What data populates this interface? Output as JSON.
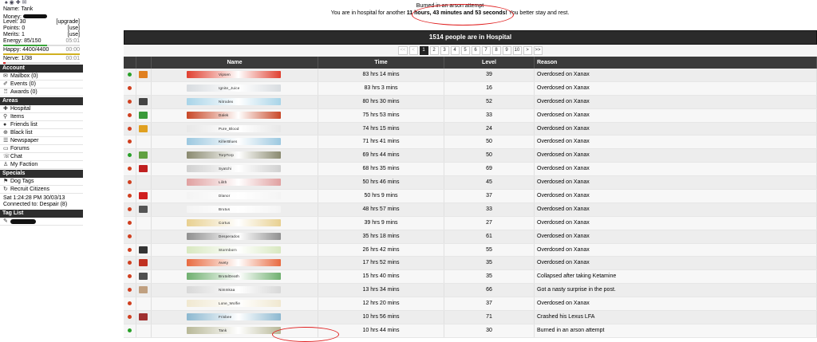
{
  "sidebar": {
    "stats": [
      {
        "label": "Name:",
        "value": "Tank"
      },
      {
        "label": "Money:",
        "value": ""
      },
      {
        "label": "Level:",
        "value": "30",
        "action": "[upgrade]"
      },
      {
        "label": "Points:",
        "value": "0",
        "action": "[use]"
      },
      {
        "label": "Merits:",
        "value": "1",
        "action": "[use]"
      },
      {
        "label": "Energy:",
        "value": "85/150",
        "timer": "05:01"
      },
      {
        "label": "Happy:",
        "value": "4400/4400",
        "timer": "00:00"
      },
      {
        "label": "Nerve:",
        "value": "1/38",
        "timer": "00:01"
      }
    ],
    "bars": {
      "energy": 0.57,
      "happy": 1.0,
      "nerve": 0.03
    },
    "colors": {
      "energy": "#3aa43a",
      "happy": "#d0b020",
      "nerve": "#d02020"
    },
    "account_title": "Account",
    "account": [
      "Mailbox (0)",
      "Events (0)",
      "Awards (0)"
    ],
    "areas_title": "Areas",
    "areas": [
      "Hospital",
      "Items",
      "Friends list",
      "Black list",
      "Newspaper",
      "Forums",
      "Chat",
      "My Faction"
    ],
    "specials_title": "Specials",
    "specials": [
      "Dog Tags",
      "Recruit Citizens"
    ],
    "datetime": "Sat 1:24:28 PM 30/03/13",
    "connected": "Connected to: Despair (8)",
    "taglist_title": "Tag List"
  },
  "banner": {
    "title": "Burned in an arson attempt",
    "prefix": "You are in hospital for another",
    "duration": "11 hours, 43 minutes and 53 seconds!",
    "suffix": "You better stay and rest."
  },
  "hospital": {
    "caption": "1514 people are in Hospital",
    "pages": [
      "<<",
      "<",
      "1",
      "2",
      "3",
      "4",
      "5",
      "6",
      "7",
      "8",
      "9",
      "10",
      ">",
      ">>"
    ],
    "current_page": "1",
    "headers": {
      "name": "Name",
      "time": "Time",
      "level": "Level",
      "reason": "Reason"
    },
    "rows": [
      {
        "name": "Vipsen",
        "time": "83 hrs 14 mins",
        "level": "39",
        "reason": "Overdosed on Xanax",
        "status": "#28a028",
        "fac": "#e08020",
        "bar": "#e04030"
      },
      {
        "name": "Ignite_Juice",
        "time": "83 hrs 3 mins",
        "level": "16",
        "reason": "Overdosed on Xanax",
        "status": "#d04020",
        "fac": "",
        "bar": "#d8dce0"
      },
      {
        "name": "Nitrodex",
        "time": "80 hrs 30 mins",
        "level": "52",
        "reason": "Overdosed on Xanax",
        "status": "#d04020",
        "fac": "#444",
        "bar": "#a8d4e8"
      },
      {
        "name": "Dalek",
        "time": "75 hrs 53 mins",
        "level": "33",
        "reason": "Overdosed on Xanax",
        "status": "#d04020",
        "fac": "#3a9a3a",
        "bar": "#c84828"
      },
      {
        "name": "Pure_Blood",
        "time": "74 hrs 15 mins",
        "level": "24",
        "reason": "Overdosed on Xanax",
        "status": "#d04020",
        "fac": "#e0a020",
        "bar": "#e8e8e8"
      },
      {
        "name": "KillerBlues",
        "time": "71 hrs 41 mins",
        "level": "50",
        "reason": "Overdosed on Xanax",
        "status": "#d04020",
        "fac": "",
        "bar": "#9cc8e0"
      },
      {
        "name": "TorpTorp",
        "time": "69 hrs 44 mins",
        "level": "50",
        "reason": "Overdosed on Xanax",
        "status": "#28a028",
        "fac": "#60a040",
        "bar": "#8a8a70"
      },
      {
        "name": "Syatchi",
        "time": "68 hrs 35 mins",
        "level": "69",
        "reason": "Overdosed on Xanax",
        "status": "#d04020",
        "fac": "#c02020",
        "bar": "#d0d0d0"
      },
      {
        "name": "Lilith",
        "time": "50 hrs 46 mins",
        "level": "45",
        "reason": "Overdosed on Xanax",
        "status": "#d04020",
        "fac": "",
        "bar": "#e0a0a0"
      },
      {
        "name": "Dlanor",
        "time": "50 hrs 9 mins",
        "level": "37",
        "reason": "Overdosed on Xanax",
        "status": "#d04020",
        "fac": "#d02020",
        "bar": "#f4f4f4"
      },
      {
        "name": "Brutus",
        "time": "48 hrs 57 mins",
        "level": "33",
        "reason": "Overdosed on Xanax",
        "status": "#d04020",
        "fac": "#555",
        "bar": "#f4f4f4"
      },
      {
        "name": "Cortus",
        "time": "39 hrs 9 mins",
        "level": "27",
        "reason": "Overdosed on Xanax",
        "status": "#d04020",
        "fac": "",
        "bar": "#e8d090"
      },
      {
        "name": "Desperados",
        "time": "35 hrs 18 mins",
        "level": "61",
        "reason": "Overdosed on Xanax",
        "status": "#d04020",
        "fac": "",
        "bar": "#909090"
      },
      {
        "name": "Stormborn",
        "time": "26 hrs 42 mins",
        "level": "55",
        "reason": "Overdosed on Xanax",
        "status": "#d04020",
        "fac": "#333",
        "bar": "#d8e8c0"
      },
      {
        "name": "Avety",
        "time": "17 hrs 52 mins",
        "level": "35",
        "reason": "Overdosed on Xanax",
        "status": "#d04020",
        "fac": "#c03020",
        "bar": "#e86a40"
      },
      {
        "name": "BrutalDeath",
        "time": "15 hrs 40 mins",
        "level": "35",
        "reason": "Collapsed after taking Ketamine",
        "status": "#d04020",
        "fac": "#505050",
        "bar": "#70b070"
      },
      {
        "name": "Nimmkaa",
        "time": "13 hrs 34 mins",
        "level": "66",
        "reason": "Got a nasty surprise in the post.",
        "status": "#d04020",
        "fac": "#c0a080",
        "bar": "#d8d8d8"
      },
      {
        "name": "Lone_Wolfie",
        "time": "12 hrs 20 mins",
        "level": "37",
        "reason": "Overdosed on Xanax",
        "status": "#d04020",
        "fac": "",
        "bar": "#f0e8d0"
      },
      {
        "name": "Frisbee",
        "time": "10 hrs 56 mins",
        "level": "71",
        "reason": "Crashed his Lexus LFA",
        "status": "#d04020",
        "fac": "#a03030",
        "bar": "#8cb8d0"
      },
      {
        "name": "Tank",
        "time": "10 hrs 44 mins",
        "level": "30",
        "reason": "Burned in an arson attempt",
        "status": "#28a028",
        "fac": "",
        "bar": "#b8b898"
      }
    ]
  }
}
